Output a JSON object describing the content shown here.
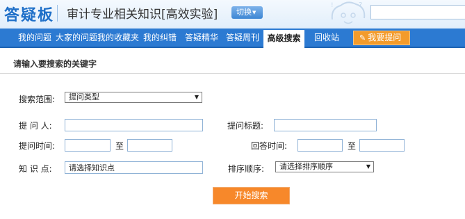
{
  "header": {
    "logo": "答疑板",
    "course": "审计专业相关知识[高效实验]",
    "switch_label": "切换",
    "switch_arrow": "▼",
    "search_value": ""
  },
  "nav": {
    "items": [
      {
        "label": "我的问题"
      },
      {
        "label": "大家的问题"
      },
      {
        "label": "我的收藏夹"
      },
      {
        "label": "我的纠错"
      },
      {
        "label": "答疑精华"
      },
      {
        "label": "答疑周刊"
      },
      {
        "label": "高级搜索"
      },
      {
        "label": "回收站"
      }
    ],
    "ask_label": "我要提问",
    "ask_icon": "✎"
  },
  "section_title": "请输入要搜索的关键字",
  "form": {
    "scope_label": "搜索范围:",
    "scope_value": "提问类型",
    "asker_label": "提 问 人:",
    "asker_value": "",
    "title_label": "提问标题:",
    "title_value": "",
    "ask_time_label": "提问时间:",
    "ask_time_from": "",
    "ask_time_to": "",
    "to_label": "至",
    "answer_time_label": "回答时间:",
    "answer_time_from": "",
    "answer_time_to": "",
    "knowledge_label": "知 识 点:",
    "knowledge_value": "请选择知识点",
    "sort_label": "排序顺序:",
    "sort_value": "请选择排序顺序",
    "select_arrow": "▼",
    "start_button": "开始搜索"
  }
}
